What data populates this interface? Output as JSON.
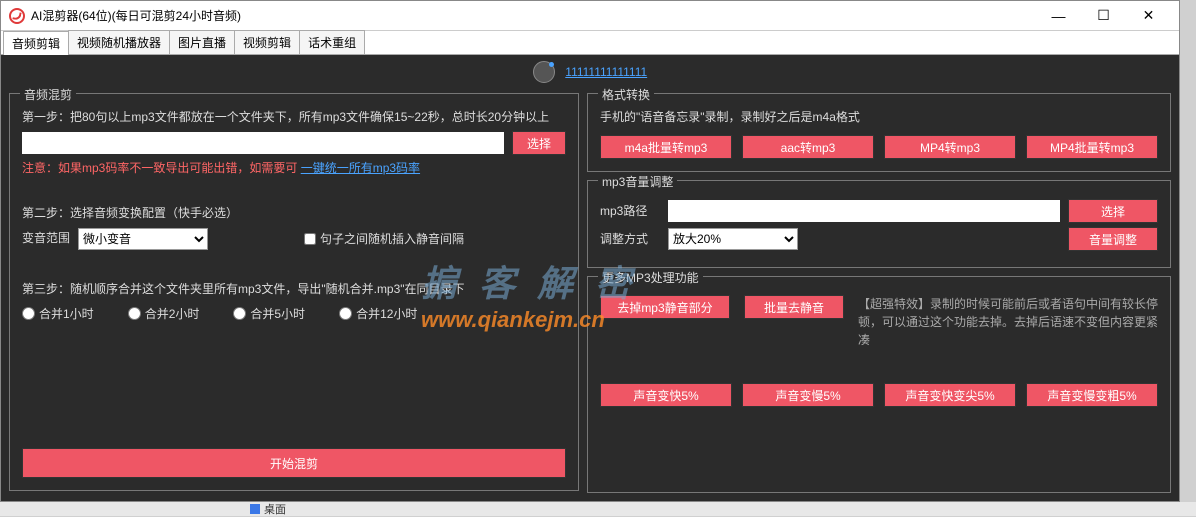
{
  "window": {
    "title": "AI混剪器(64位)(每日可混剪24小时音频)"
  },
  "tabs": [
    "音频剪辑",
    "视频随机播放器",
    "图片直播",
    "视频剪辑",
    "话术重组"
  ],
  "account": {
    "link": "11111111111111"
  },
  "left": {
    "legend": "音频混剪",
    "step1": "第一步：把80句以上mp3文件都放在一个文件夹下，所有mp3文件确保15~22秒，总时长20分钟以上",
    "select_btn": "选择",
    "note_prefix": "注意：如果mp3码率不一致导出可能出错，如需要可",
    "note_link": "一键统一所有mp3码率",
    "step2": "第二步：选择音频变换配置（快手必选）",
    "voice_range_label": "变音范围",
    "voice_range_value": "微小变音",
    "insert_silence": "句子之间随机插入静音间隔",
    "step3": "第三步：随机顺序合并这个文件夹里所有mp3文件，导出\"随机合并.mp3\"在同目录下",
    "radios": [
      "合并1小时",
      "合并2小时",
      "合并5小时",
      "合并12小时"
    ],
    "start_btn": "开始混剪"
  },
  "format": {
    "legend": "格式转换",
    "desc": "手机的\"语音备忘录\"录制，录制好之后是m4a格式",
    "btns": [
      "m4a批量转mp3",
      "aac转mp3",
      "MP4转mp3",
      "MP4批量转mp3"
    ]
  },
  "volume": {
    "legend": "mp3音量调整",
    "path_label": "mp3路径",
    "select_btn": "选择",
    "method_label": "调整方式",
    "method_value": "放大20%",
    "adjust_btn": "音量调整"
  },
  "more": {
    "legend": "更多MP3处理功能",
    "btns_row1": [
      "去掉mp3静音部分",
      "批量去静音"
    ],
    "hint": "【超强特效】录制的时候可能前后或者语句中间有较长停顿，可以通过这个功能去掉。去掉后语速不变但内容更紧凑",
    "btns_row2": [
      "声音变快5%",
      "声音变慢5%",
      "声音变快变尖5%",
      "声音变慢变粗5%"
    ]
  },
  "watermark": {
    "line1": "掮 客 解 密",
    "line2": "www.qiankejm.cn"
  },
  "taskbar": {
    "label": "桌面"
  }
}
